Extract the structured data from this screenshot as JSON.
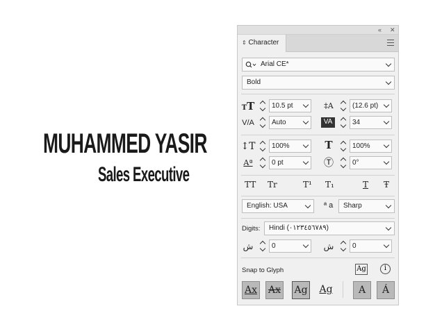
{
  "card": {
    "name": "MUHAMMED YASIR",
    "role": "Sales Executive"
  },
  "panel": {
    "topbar": {
      "collapse": "«",
      "close": "✕"
    },
    "tab_label": "Character",
    "font_family": "Arial CE*",
    "font_style": "Bold",
    "font_size": "10.5 pt",
    "leading": "(12.6 pt)",
    "kerning": "Auto",
    "tracking": "34",
    "vertical_scale": "100%",
    "horizontal_scale": "100%",
    "baseline_shift": "0 pt",
    "char_rotation": "0°",
    "type_buttons": [
      "TT",
      "Tr",
      "T¹",
      "T₁",
      "T",
      "Ŧ"
    ],
    "language": "English: USA",
    "aa_label": "ª a",
    "antialias": "Sharp",
    "digits_label": "Digits:",
    "digits_value": "Hindi (٠١٢٣٤٥٦٧٨٩)",
    "arabic_field_1": "0",
    "arabic_field_2": "0",
    "snap_label": "Snap to Glyph",
    "snap_buttons": [
      "Ax",
      "Ax",
      "Ag",
      "Ag",
      "A",
      "Á"
    ]
  }
}
